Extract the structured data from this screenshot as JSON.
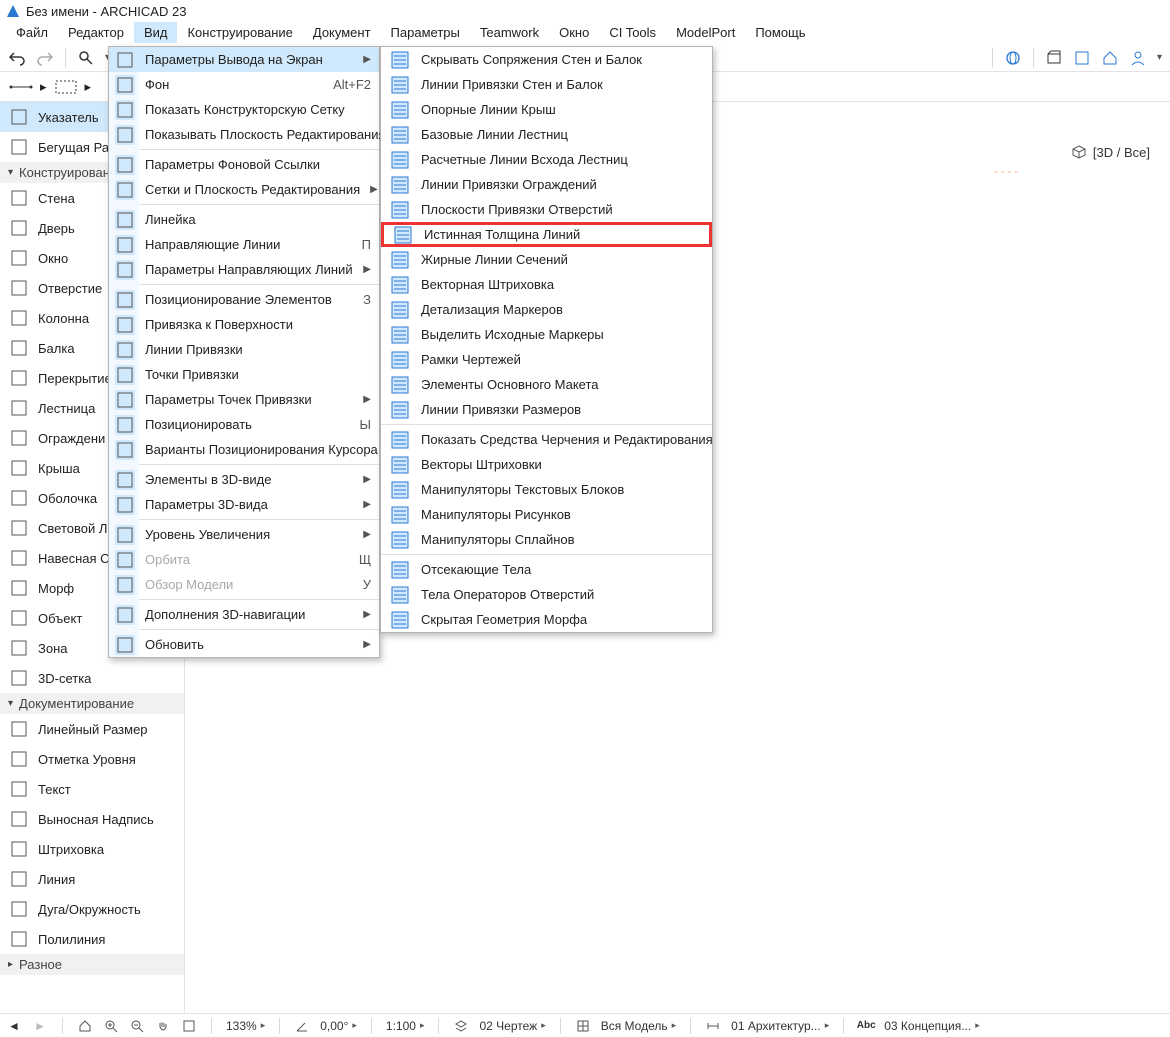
{
  "title": "Без имени - ARCHICAD 23",
  "menubar": [
    "Файл",
    "Редактор",
    "Вид",
    "Конструирование",
    "Документ",
    "Параметры",
    "Teamwork",
    "Окно",
    "CI Tools",
    "ModelPort",
    "Помощь"
  ],
  "menubar_active_index": 2,
  "view_menu": [
    {
      "type": "item",
      "label": "Параметры Вывода на Экран",
      "arrow": true,
      "highlight": true
    },
    {
      "type": "item",
      "label": "Фон",
      "shortcut": "Alt+F2"
    },
    {
      "type": "item",
      "label": "Показать Конструкторскую Сетку"
    },
    {
      "type": "item",
      "label": "Показывать Плоскость Редактирования"
    },
    {
      "type": "sep"
    },
    {
      "type": "item",
      "label": "Параметры Фоновой Ссылки"
    },
    {
      "type": "item",
      "label": "Сетки и Плоскость Редактирования",
      "arrow": true
    },
    {
      "type": "sep"
    },
    {
      "type": "item",
      "label": "Линейка"
    },
    {
      "type": "item",
      "label": "Направляющие Линии",
      "shortcut": "П"
    },
    {
      "type": "item",
      "label": "Параметры Направляющих Линий",
      "arrow": true
    },
    {
      "type": "sep"
    },
    {
      "type": "item",
      "label": "Позиционирование Элементов",
      "shortcut": "З"
    },
    {
      "type": "item",
      "label": "Привязка к Поверхности"
    },
    {
      "type": "item",
      "label": "Линии Привязки"
    },
    {
      "type": "item",
      "label": "Точки Привязки"
    },
    {
      "type": "item",
      "label": "Параметры Точек Привязки",
      "arrow": true
    },
    {
      "type": "item",
      "label": "Позиционировать",
      "shortcut": "Ы"
    },
    {
      "type": "item",
      "label": "Варианты Позиционирования Курсора",
      "arrow": true
    },
    {
      "type": "sep"
    },
    {
      "type": "item",
      "label": "Элементы в 3D-виде",
      "arrow": true
    },
    {
      "type": "item",
      "label": "Параметры 3D-вида",
      "arrow": true
    },
    {
      "type": "sep"
    },
    {
      "type": "item",
      "label": "Уровень Увеличения",
      "arrow": true
    },
    {
      "type": "item",
      "label": "Орбита",
      "shortcut": "Щ",
      "disabled": true
    },
    {
      "type": "item",
      "label": "Обзор Модели",
      "shortcut": "У",
      "disabled": true
    },
    {
      "type": "sep"
    },
    {
      "type": "item",
      "label": "Дополнения 3D-навигации",
      "arrow": true
    },
    {
      "type": "sep"
    },
    {
      "type": "item",
      "label": "Обновить",
      "arrow": true
    }
  ],
  "submenu": [
    {
      "label": "Скрывать Сопряжения Стен и Балок"
    },
    {
      "label": "Линии Привязки Стен и Балок"
    },
    {
      "label": "Опорные Линии Крыш"
    },
    {
      "label": "Базовые Линии Лестниц"
    },
    {
      "label": "Расчетные Линии Всхода Лестниц"
    },
    {
      "label": "Линии Привязки Ограждений"
    },
    {
      "label": "Плоскости Привязки Отверстий"
    },
    {
      "label": "Истинная Толщина Линий",
      "red": true
    },
    {
      "label": "Жирные Линии Сечений"
    },
    {
      "label": "Векторная Штриховка"
    },
    {
      "label": "Детализация Маркеров"
    },
    {
      "label": "Выделить Исходные Маркеры"
    },
    {
      "label": "Рамки Чертежей"
    },
    {
      "label": "Элементы Основного Макета"
    },
    {
      "label": "Линии Привязки Размеров"
    },
    {
      "sep": true
    },
    {
      "label": "Показать Средства Черчения и Редактирования"
    },
    {
      "label": "Векторы Штриховки"
    },
    {
      "label": "Манипуляторы Текстовых Блоков"
    },
    {
      "label": "Манипуляторы Рисунков"
    },
    {
      "label": "Манипуляторы Сплайнов"
    },
    {
      "sep": true
    },
    {
      "label": "Отсекающие Тела"
    },
    {
      "label": "Тела Операторов Отверстий"
    },
    {
      "label": "Скрытая Геометрия Морфа"
    }
  ],
  "toolbox": {
    "sections": [
      {
        "collapsible": false,
        "rows": [
          {
            "label": "Указатель",
            "sel": true
          },
          {
            "label": "Бегущая Ра"
          }
        ]
      },
      {
        "head": "Конструировани",
        "rows": [
          {
            "label": "Стена"
          },
          {
            "label": "Дверь"
          },
          {
            "label": "Окно"
          },
          {
            "label": "Отверстие"
          },
          {
            "label": "Колонна"
          },
          {
            "label": "Балка"
          },
          {
            "label": "Перекрытие"
          },
          {
            "label": "Лестница"
          },
          {
            "label": "Ограждени"
          },
          {
            "label": "Крыша"
          },
          {
            "label": "Оболочка"
          },
          {
            "label": "Световой Л"
          },
          {
            "label": "Навесная С"
          },
          {
            "label": "Морф"
          },
          {
            "label": "Объект"
          },
          {
            "label": "Зона"
          },
          {
            "label": "3D-сетка"
          }
        ]
      },
      {
        "head": "Документирование",
        "rows": [
          {
            "label": "Линейный Размер"
          },
          {
            "label": "Отметка Уровня"
          },
          {
            "label": "Текст"
          },
          {
            "label": "Выносная Надпись"
          },
          {
            "label": "Штриховка"
          },
          {
            "label": "Линия"
          },
          {
            "label": "Дуга/Окружность"
          },
          {
            "label": "Полилиния"
          }
        ]
      },
      {
        "head": "Разное",
        "rows": []
      }
    ]
  },
  "view_tab": "[3D / Все]",
  "statusbar": {
    "zoom": "133%",
    "angle": "0,00°",
    "scale": "1:100",
    "drawing": "02 Чертеж",
    "model": "Вся Модель",
    "arch": "01 Архитектур...",
    "concept": "03 Концепция..."
  }
}
